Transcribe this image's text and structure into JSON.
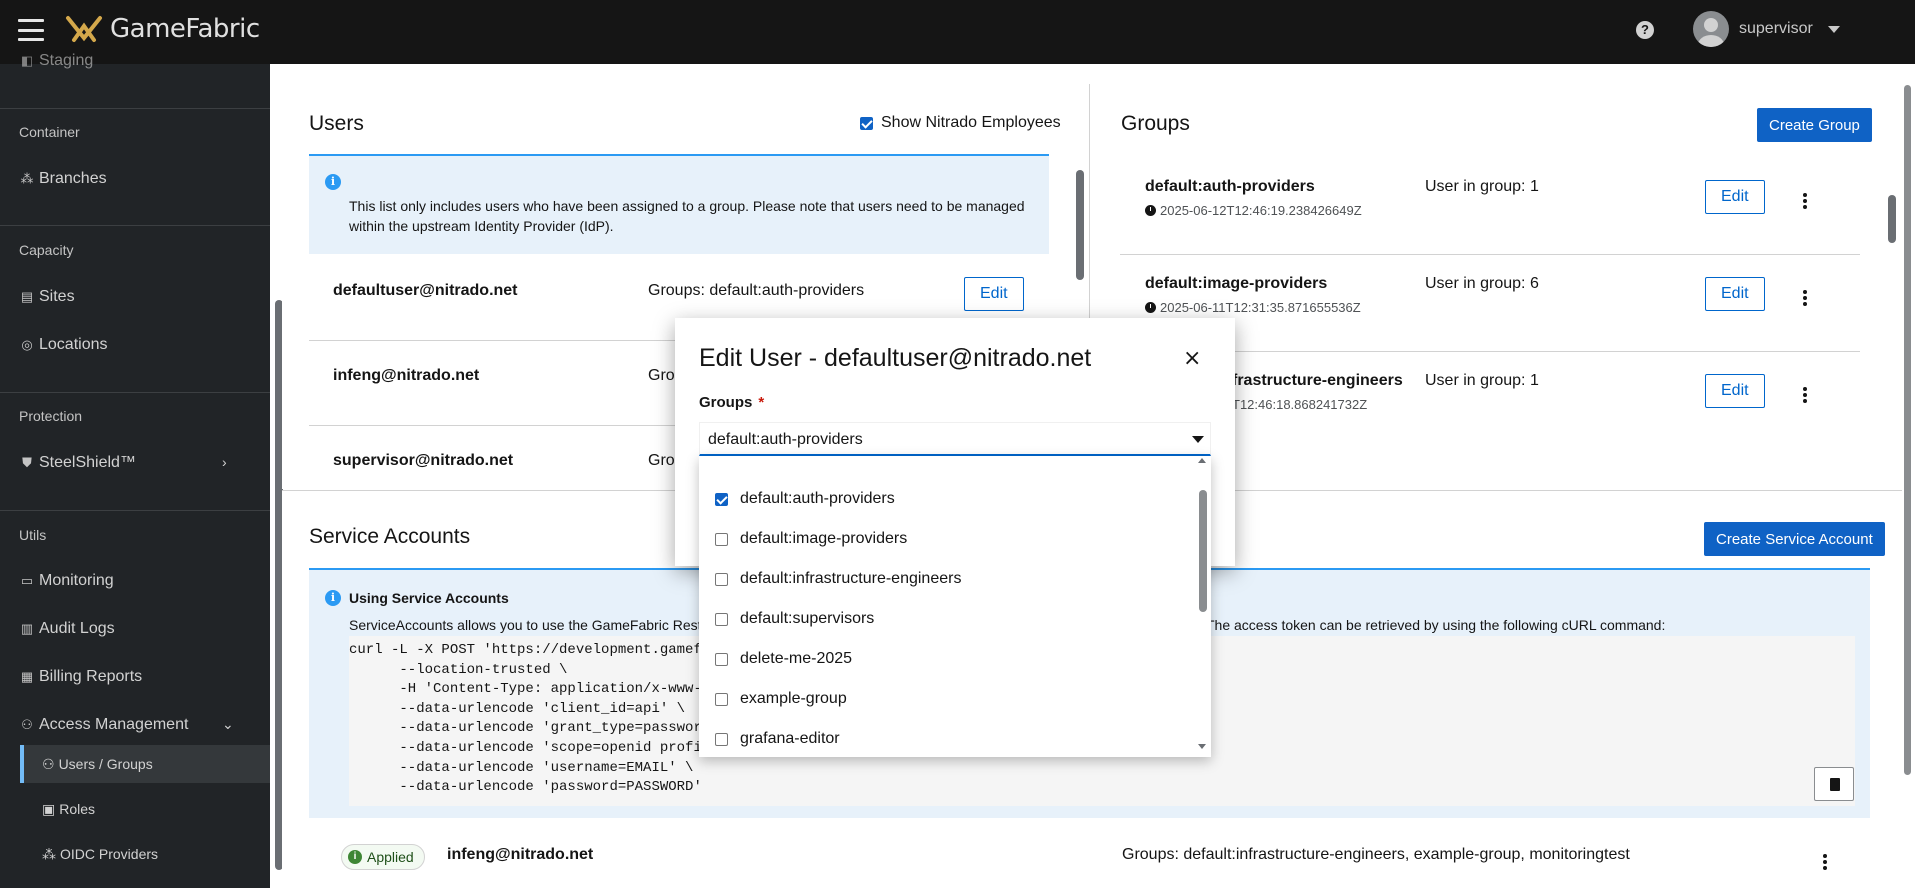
{
  "header": {
    "app_name": "GameFabric",
    "help_label": "?",
    "username": "supervisor"
  },
  "sidebar": {
    "staging_label": "Staging",
    "sections": [
      {
        "title": "Container",
        "items": [
          {
            "label": "Branches",
            "icon": "branches-icon"
          }
        ]
      },
      {
        "title": "Capacity",
        "items": [
          {
            "label": "Sites",
            "icon": "building-icon"
          },
          {
            "label": "Locations",
            "icon": "globe-icon"
          }
        ]
      },
      {
        "title": "Protection",
        "items": [
          {
            "label": "SteelShield™",
            "icon": "shield-icon"
          }
        ]
      },
      {
        "title": "Utils",
        "items": [
          {
            "label": "Monitoring",
            "icon": "monitor-icon"
          },
          {
            "label": "Audit Logs",
            "icon": "book-icon"
          },
          {
            "label": "Billing Reports",
            "icon": "report-icon"
          }
        ]
      }
    ],
    "access_management": {
      "label": "Access Management",
      "sub_items": [
        "Users / Groups",
        "Roles",
        "OIDC Providers"
      ],
      "active": "Users / Groups"
    }
  },
  "users_panel": {
    "title": "Users",
    "show_nitrado_label": "Show Nitrado Employees",
    "show_nitrado_checked": true,
    "info_text": "This list only includes users who have been assigned to a group. Please note that users need to be managed within the upstream Identity Provider (IdP).",
    "edit_label": "Edit",
    "rows": [
      {
        "email": "defaultuser@nitrado.net",
        "groups": "Groups: default:auth-providers"
      },
      {
        "email": "infeng@nitrado.net",
        "groups": "Gro"
      },
      {
        "email": "supervisor@nitrado.net",
        "groups": "Gro"
      }
    ]
  },
  "groups_panel": {
    "title": "Groups",
    "create_label": "Create Group",
    "edit_label": "Edit",
    "rows": [
      {
        "name": "default:auth-providers",
        "time": "2025-06-12T12:46:19.238426649Z",
        "count": "User in group: 1"
      },
      {
        "name": "default:image-providers",
        "time": "2025-06-11T12:31:35.871655536Z",
        "count": "User in group: 6"
      },
      {
        "name": "frastructure-engineers",
        "time": "T12:46:18.868241732Z",
        "count": "User in group: 1"
      }
    ]
  },
  "service_accounts": {
    "title": "Service Accounts",
    "create_label": "Create Service Account",
    "info_title": "Using Service Accounts",
    "info_desc_left": "ServiceAccounts allows you to use the GameFabric Rest",
    "info_desc_right": "t an access token. The access token can be retrieved by using the following cURL command:",
    "code_lines": [
      "curl -L -X POST 'https://development.gamef",
      "      --location-trusted \\",
      "      -H 'Content-Type: application/x-www-",
      "      --data-urlencode 'client_id=api' \\",
      "      --data-urlencode 'grant_type=passwor",
      "      --data-urlencode 'scope=openid profi",
      "      --data-urlencode 'username=EMAIL' \\",
      "      --data-urlencode 'password=PASSWORD'"
    ],
    "row": {
      "status": "Applied",
      "email": "infeng@nitrado.net",
      "groups": "Groups: default:infrastructure-engineers, example-group, monitoringtest"
    }
  },
  "modal": {
    "title": "Edit User - defaultuser@nitrado.net",
    "close_label": "×",
    "groups_label": "Groups",
    "required_mark": "*",
    "selected_value": "default:auth-providers",
    "options": [
      {
        "label": "default:auth-providers",
        "checked": true
      },
      {
        "label": "default:image-providers",
        "checked": false
      },
      {
        "label": "default:infrastructure-engineers",
        "checked": false
      },
      {
        "label": "default:supervisors",
        "checked": false
      },
      {
        "label": "delete-me-2025",
        "checked": false
      },
      {
        "label": "example-group",
        "checked": false
      },
      {
        "label": "grafana-editor",
        "checked": false
      }
    ]
  },
  "colors": {
    "primary": "#0f62c5",
    "link": "#0066cc",
    "header_bg": "#151515",
    "sidebar_bg": "#212427",
    "info_bg": "#e7f1fa",
    "active_accent": "#73bcf7",
    "success": "#3e8635"
  }
}
